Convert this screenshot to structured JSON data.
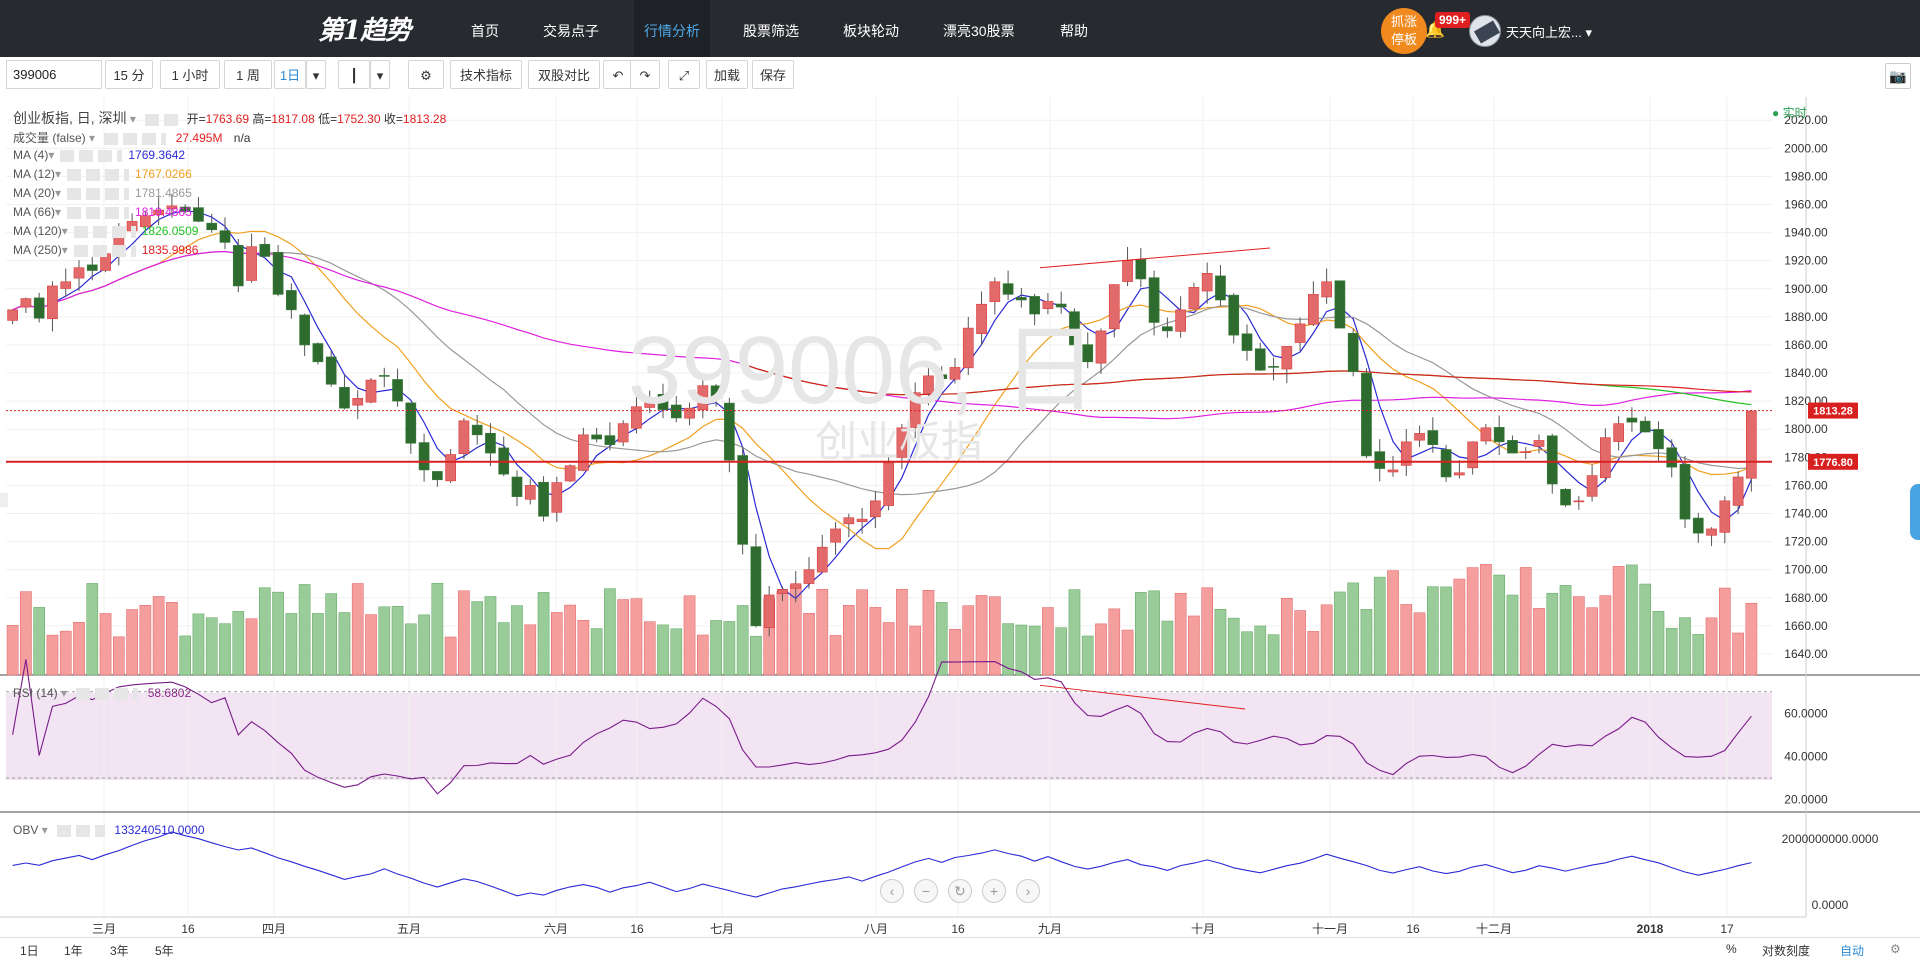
{
  "app": {
    "logo": "第1趋势"
  },
  "nav": {
    "items": [
      "首页",
      "交易点子",
      "行情分析",
      "股票筛选",
      "板块轮动",
      "漂亮30股票",
      "帮助"
    ],
    "active_index": 2,
    "badge_line1": "抓涨",
    "badge_line2": "停板",
    "notify_count": "999+",
    "username": "天天向上宏..."
  },
  "toolbar": {
    "symbol": "399006",
    "intervals": [
      "15 分",
      "1 小时",
      "1 周",
      "1日"
    ],
    "active_interval": "1日",
    "indicators_label": "技术指标",
    "compare_label": "双股对比",
    "load_label": "加载",
    "save_label": "保存"
  },
  "legend": {
    "title": "创业板指, 日, 深圳",
    "open_label": "开=",
    "open": "1763.69",
    "high_label": "高=",
    "high": "1817.08",
    "low_label": "低=",
    "low": "1752.30",
    "close_label": "收=",
    "close": "1813.28",
    "volume_name": "成交量 (false)",
    "volume_value": "27.495M",
    "volume_extra": "n/a",
    "ma": [
      {
        "name": "MA (4)",
        "value": "1769.3642",
        "color": "#2a2ad6"
      },
      {
        "name": "MA (12)",
        "value": "1767.0266",
        "color": "#f0a020"
      },
      {
        "name": "MA (20)",
        "value": "1781.4865",
        "color": "#999999"
      },
      {
        "name": "MA (66)",
        "value": "1819.4865",
        "color": "#e020e0"
      },
      {
        "name": "MA (120)",
        "value": "1826.0509",
        "color": "#22c222"
      },
      {
        "name": "MA (250)",
        "value": "1835.9986",
        "color": "#e02020"
      }
    ],
    "realtime": "实时"
  },
  "watermark": {
    "code": "399006, 日",
    "name": "创业板指"
  },
  "rsi": {
    "name": "RSI (14)",
    "value": "58.6802"
  },
  "obv": {
    "name": "OBV",
    "value": "133240510.0000"
  },
  "price_axis": {
    "ticks": [
      "2020.00",
      "2000.00",
      "1980.00",
      "1960.00",
      "1940.00",
      "1920.00",
      "1900.00",
      "1880.00",
      "1860.00",
      "1840.00",
      "1820.00",
      "1800.00",
      "1780.00",
      "1760.00",
      "1740.00",
      "1720.00",
      "1700.00",
      "1680.00",
      "1660.00",
      "1640.00"
    ],
    "last_price_tag": "1813.28",
    "hline_tag": "1776.80"
  },
  "rsi_axis": {
    "ticks": [
      "60.0000",
      "40.0000",
      "20.0000"
    ]
  },
  "obv_axis": {
    "ticks": [
      "2000000000.0000",
      "0.0000"
    ]
  },
  "time_axis": {
    "labels": [
      "三月",
      "16",
      "四月",
      "五月",
      "六月",
      "16",
      "七月",
      "八月",
      "16",
      "九月",
      "十月",
      "十一月",
      "16",
      "十二月",
      "2018",
      "17"
    ]
  },
  "bottom": {
    "ranges": [
      "1日",
      "1年",
      "3年",
      "5年"
    ],
    "pct_label": "%",
    "log_label": "对数刻度",
    "auto_label": "自动"
  },
  "chart_data": {
    "type": "candlestick",
    "title": "创业板指, 日, 深圳",
    "ylim": [
      1625,
      2028
    ],
    "horizontal_line": 1776.8,
    "last_close": 1813.28,
    "closes": [
      1885,
      1893,
      1879,
      1902,
      1905,
      1915,
      1913,
      1925,
      1941,
      1948,
      1952,
      1956,
      1959,
      1955,
      1948,
      1942,
      1933,
      1902,
      1930,
      1923,
      1896,
      1885,
      1860,
      1848,
      1832,
      1815,
      1822,
      1835,
      1838,
      1820,
      1790,
      1771,
      1764,
      1782,
      1806,
      1796,
      1783,
      1768,
      1752,
      1760,
      1738,
      1762,
      1774,
      1796,
      1793,
      1789,
      1804,
      1816,
      1821,
      1814,
      1808,
      1815,
      1831,
      1822,
      1778,
      1718,
      1660,
      1682,
      1686,
      1690,
      1700,
      1716,
      1729,
      1737,
      1736,
      1749,
      1776,
      1801,
      1826,
      1838,
      1836,
      1844,
      1872,
      1889,
      1905,
      1896,
      1892,
      1882,
      1891,
      1887,
      1860,
      1848,
      1870,
      1903,
      1920,
      1907,
      1876,
      1870,
      1885,
      1901,
      1911,
      1892,
      1867,
      1856,
      1842,
      1844,
      1859,
      1875,
      1896,
      1905,
      1872,
      1841,
      1781,
      1772,
      1771,
      1791,
      1797,
      1789,
      1766,
      1769,
      1791,
      1801,
      1791,
      1783,
      1784,
      1792,
      1761,
      1746,
      1749,
      1767,
      1794,
      1804,
      1805,
      1798,
      1786,
      1773,
      1736,
      1726,
      1729,
      1749,
      1766,
      1813
    ],
    "rsi_last": 58.6802,
    "obv_last": 133240510
  }
}
